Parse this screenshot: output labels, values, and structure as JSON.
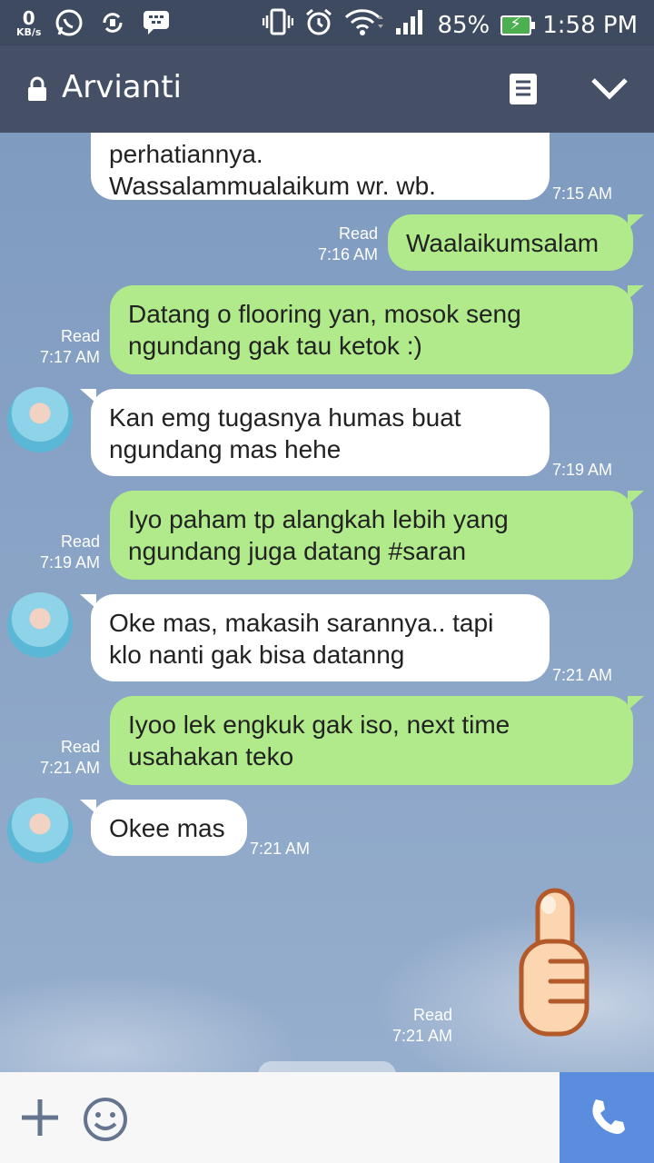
{
  "status_bar": {
    "data_rate": "0",
    "data_unit": "KB/s",
    "battery": "85%",
    "time": "1:58 PM"
  },
  "header": {
    "contact_name": "Arvianti"
  },
  "messages": [
    {
      "side": "in",
      "text": "perhatiannya.\nWassalammualaikum wr. wb.",
      "time": "7:15 AM",
      "read": ""
    },
    {
      "side": "out",
      "text": "Waalaikumsalam",
      "time": "7:16 AM",
      "read": "Read"
    },
    {
      "side": "out",
      "text": "Datang o flooring yan, mosok seng ngundang gak tau ketok :)",
      "time": "7:17 AM",
      "read": "Read"
    },
    {
      "side": "in",
      "text": "Kan emg tugasnya humas buat ngundang mas hehe",
      "time": "7:19 AM",
      "read": ""
    },
    {
      "side": "out",
      "text": "Iyo paham tp alangkah lebih yang ngundang juga datang #saran",
      "time": "7:19 AM",
      "read": "Read"
    },
    {
      "side": "in",
      "text": "Oke mas, makasih sarannya.. tapi klo nanti gak bisa datanng",
      "time": "7:21 AM",
      "read": ""
    },
    {
      "side": "out",
      "text": "Iyoo lek engkuk gak iso, next time usahakan teko",
      "time": "7:21 AM",
      "read": "Read"
    },
    {
      "side": "in",
      "text": "Okee mas",
      "time": "7:21 AM",
      "read": ""
    },
    {
      "side": "out",
      "sticker": "thumbs-up-sticker",
      "time": "7:21 AM",
      "read": "Read"
    }
  ],
  "colors": {
    "outgoing": "#b0ea8a",
    "incoming": "#ffffff",
    "header": "#455067",
    "call_button": "#5b8ddf"
  }
}
